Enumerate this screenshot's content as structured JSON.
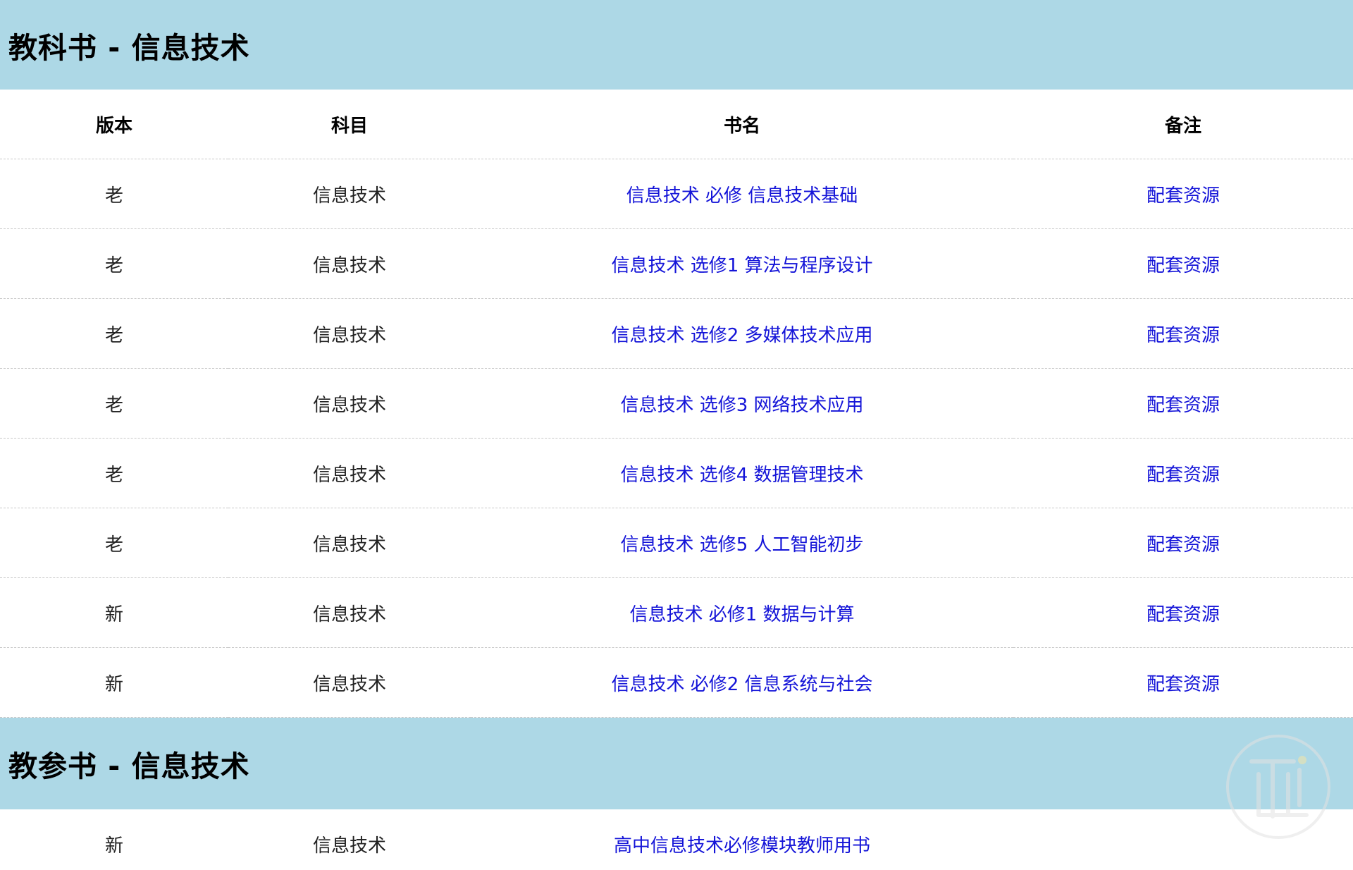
{
  "section1": {
    "title": "教科书 - 信息技术",
    "columns": [
      "版本",
      "科目",
      "书名",
      "备注"
    ],
    "rows": [
      {
        "edition": "老",
        "subject": "信息技术",
        "book": "信息技术 必修 信息技术基础",
        "note": "配套资源"
      },
      {
        "edition": "老",
        "subject": "信息技术",
        "book": "信息技术 选修1 算法与程序设计",
        "note": "配套资源"
      },
      {
        "edition": "老",
        "subject": "信息技术",
        "book": "信息技术 选修2 多媒体技术应用",
        "note": "配套资源"
      },
      {
        "edition": "老",
        "subject": "信息技术",
        "book": "信息技术 选修3 网络技术应用",
        "note": "配套资源"
      },
      {
        "edition": "老",
        "subject": "信息技术",
        "book": "信息技术 选修4 数据管理技术",
        "note": "配套资源"
      },
      {
        "edition": "老",
        "subject": "信息技术",
        "book": "信息技术 选修5 人工智能初步",
        "note": "配套资源"
      },
      {
        "edition": "新",
        "subject": "信息技术",
        "book": "信息技术 必修1 数据与计算",
        "note": "配套资源"
      },
      {
        "edition": "新",
        "subject": "信息技术",
        "book": "信息技术 必修2 信息系统与社会",
        "note": "配套资源"
      }
    ]
  },
  "section2": {
    "title": "教参书 - 信息技术",
    "rows": [
      {
        "edition": "新",
        "subject": "信息技术",
        "book": "高中信息技术必修模块教师用书",
        "note": ""
      }
    ]
  },
  "colors": {
    "header_bg": "#add8e6",
    "link": "#1414d8"
  },
  "icons": {
    "watermark": "logo-watermark-icon"
  }
}
